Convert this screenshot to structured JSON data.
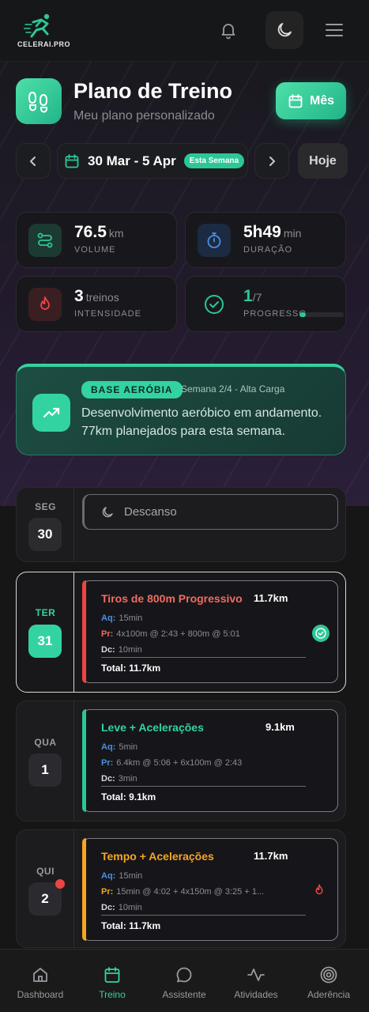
{
  "brand": {
    "name": "CELERAI.PRO"
  },
  "header": {
    "title": "Plano de Treino",
    "subtitle": "Meu plano personalizado",
    "month_button": "Mês"
  },
  "week": {
    "range": "30 Mar - 5 Apr",
    "badge": "Esta Semana",
    "today_button": "Hoje"
  },
  "stats": {
    "volume": {
      "value": "76.5",
      "unit": "km",
      "label": "VOLUME"
    },
    "duration": {
      "value": "5h49",
      "unit": "min",
      "label": "DURAÇÃO"
    },
    "intensity": {
      "value": "3",
      "unit": "treinos",
      "label": "INTENSIDADE"
    },
    "progress": {
      "value": "1",
      "unit": "/7",
      "label": "PROGRESSO",
      "fraction": 0.14
    }
  },
  "phase": {
    "badge": "BASE AERÓBIA",
    "week": "Semana 2/4 - Alta Carga",
    "description": "Desenvolvimento aeróbico em andamento. 77km planejados para esta semana."
  },
  "days": [
    {
      "name": "SEG",
      "number": "30",
      "rest_label": "Descanso"
    },
    {
      "name": "TER",
      "number": "31",
      "title": "Tiros de 800m Progressivo",
      "distance": "11.7km",
      "aq_label": "Aq:",
      "aq": "15min",
      "pr_label": "Pr:",
      "pr": "4x100m @ 2:43 + 800m @ 5:01",
      "dc_label": "Dc:",
      "dc": "10min",
      "total": "Total: 11.7km",
      "accent": "#ef4444"
    },
    {
      "name": "QUA",
      "number": "1",
      "title": "Leve + Acelerações",
      "distance": "9.1km",
      "aq_label": "Aq:",
      "aq": "5min",
      "pr_label": "Pr:",
      "pr": "6.4km @ 5:06 + 6x100m @ 2:43",
      "dc_label": "Dc:",
      "dc": "3min",
      "total": "Total: 9.1km",
      "accent": "#2cc796"
    },
    {
      "name": "QUI",
      "number": "2",
      "title": "Tempo + Acelerações",
      "distance": "11.7km",
      "aq_label": "Aq:",
      "aq": "15min",
      "pr_label": "Pr:",
      "pr": "15min @ 4:02 + 4x150m @ 3:25 + 1...",
      "dc_label": "Dc:",
      "dc": "10min",
      "total": "Total: 11.7km",
      "accent": "#f5a524"
    }
  ],
  "bottom_nav": [
    {
      "label": "Dashboard"
    },
    {
      "label": "Treino"
    },
    {
      "label": "Assistente"
    },
    {
      "label": "Atividades"
    },
    {
      "label": "Aderência"
    }
  ]
}
